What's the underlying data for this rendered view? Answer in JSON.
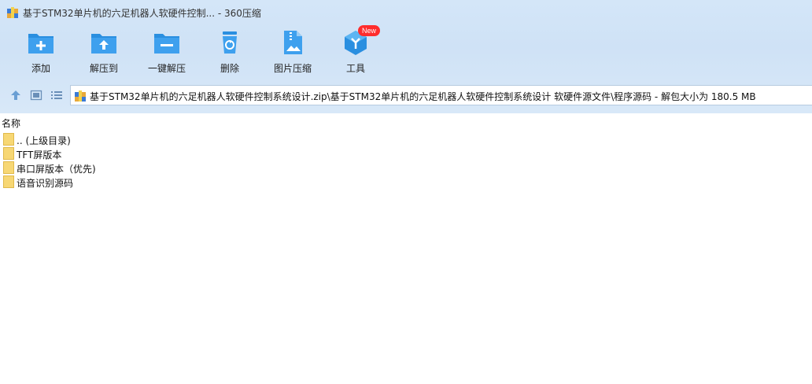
{
  "window": {
    "title": "基于STM32单片机的六足机器人软硬件控制... - 360压缩",
    "app_icon": "archive-icon"
  },
  "toolbar": {
    "buttons": [
      {
        "label": "添加",
        "icon": "add-folder-icon"
      },
      {
        "label": "解压到",
        "icon": "extract-to-icon"
      },
      {
        "label": "一键解压",
        "icon": "one-click-extract-icon"
      },
      {
        "label": "删除",
        "icon": "delete-icon"
      },
      {
        "label": "图片压缩",
        "icon": "image-compress-icon"
      },
      {
        "label": "工具",
        "icon": "tools-icon"
      }
    ],
    "badge": "New"
  },
  "address_bar": {
    "path": "基于STM32单片机的六足机器人软硬件控制系统设计.zip\\基于STM32单片机的六足机器人软硬件控制系统设计 软硬件源文件\\程序源码 - 解包大小为 180.5 MB"
  },
  "list": {
    "column_name": "名称",
    "rows": [
      {
        "name": ".. (上级目录)"
      },
      {
        "name": "TFT屏版本"
      },
      {
        "name": "串口屏版本（优先)"
      },
      {
        "name": "语音识别源码"
      }
    ]
  },
  "colors": {
    "accent": "#2a8fe0",
    "badge": "#ff2d2d",
    "folder": "#f7d774"
  }
}
